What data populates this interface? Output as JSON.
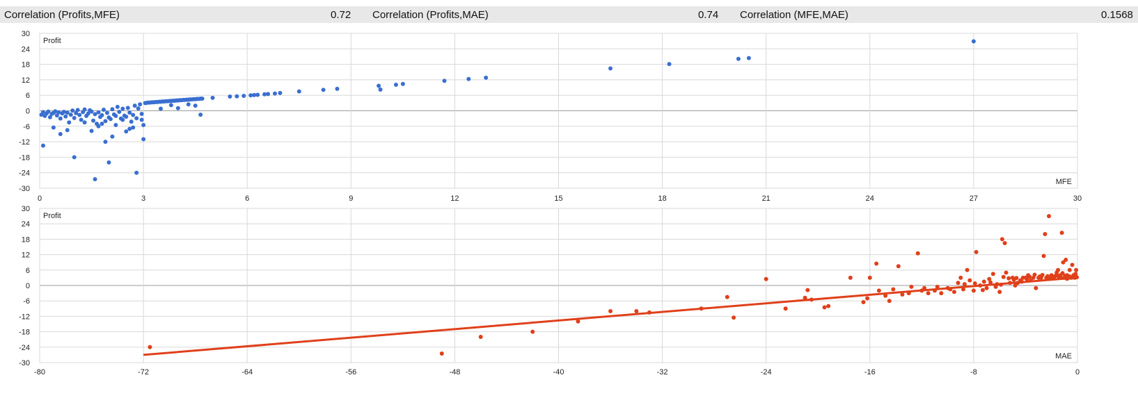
{
  "header": {
    "label1": "Correlation (Profits,MFE)",
    "value1": "0.72",
    "label2": "Correlation (Profits,MAE)",
    "value2": "0.74",
    "label3": "Correlation (MFE,MAE)",
    "value3": "0.1568"
  },
  "chart_data": [
    {
      "type": "scatter",
      "ylabel": "Profit",
      "xlabel": "MFE",
      "xlim": [
        0,
        30
      ],
      "ylim": [
        -30,
        30
      ],
      "xticks": [
        "0",
        "3",
        "6",
        "9",
        "12",
        "15",
        "18",
        "21",
        "24",
        "27",
        "30"
      ],
      "yticks": [
        "30",
        "24",
        "18",
        "12",
        "6",
        "0",
        "-6",
        "-12",
        "-18",
        "-24",
        "-30"
      ],
      "grid": true,
      "color": "#3a6fd0",
      "points": [
        [
          0.05,
          -1.5
        ],
        [
          0.1,
          -0.5
        ],
        [
          0.15,
          -2
        ],
        [
          0.2,
          -1
        ],
        [
          0.25,
          -0.3
        ],
        [
          0.3,
          -2.5
        ],
        [
          0.35,
          -1.2
        ],
        [
          0.4,
          -0.8
        ],
        [
          0.45,
          -0.2
        ],
        [
          0.5,
          -1.8
        ],
        [
          0.55,
          -0.6
        ],
        [
          0.6,
          -3
        ],
        [
          0.65,
          -1
        ],
        [
          0.7,
          -0.4
        ],
        [
          0.75,
          -2.2
        ],
        [
          0.8,
          -0.7
        ],
        [
          0.85,
          -4.5
        ],
        [
          0.9,
          -1.5
        ],
        [
          0.95,
          0.1
        ],
        [
          1.0,
          -2.8
        ],
        [
          1.05,
          -0.9
        ],
        [
          1.1,
          0.3
        ],
        [
          1.15,
          -1.6
        ],
        [
          1.2,
          -3.5
        ],
        [
          1.25,
          -0.5
        ],
        [
          1.3,
          0.5
        ],
        [
          1.35,
          -2
        ],
        [
          1.4,
          -1.1
        ],
        [
          1.45,
          0.2
        ],
        [
          1.5,
          -0.3
        ],
        [
          1.55,
          -3.8
        ],
        [
          1.6,
          -1.3
        ],
        [
          1.65,
          -5
        ],
        [
          1.7,
          -0.6
        ],
        [
          1.75,
          -2.4
        ],
        [
          1.8,
          -1.7
        ],
        [
          1.85,
          0.4
        ],
        [
          1.9,
          -4
        ],
        [
          1.95,
          -0.8
        ],
        [
          2.0,
          -2.6
        ],
        [
          2.05,
          -3.2
        ],
        [
          2.1,
          0.6
        ],
        [
          2.15,
          -1.4
        ],
        [
          2.2,
          -2
        ],
        [
          2.25,
          1.5
        ],
        [
          2.3,
          -0.4
        ],
        [
          2.35,
          -3
        ],
        [
          2.4,
          0.8
        ],
        [
          2.45,
          -1.9
        ],
        [
          2.5,
          -2.3
        ],
        [
          2.55,
          1.1
        ],
        [
          2.6,
          -0.7
        ],
        [
          2.65,
          -4.2
        ],
        [
          2.7,
          -1.6
        ],
        [
          2.75,
          2
        ],
        [
          2.8,
          -2.9
        ],
        [
          2.85,
          0.9
        ],
        [
          2.9,
          2.5
        ],
        [
          2.95,
          -1.2
        ],
        [
          3.0,
          -5.5
        ],
        [
          0.1,
          -13.5
        ],
        [
          0.4,
          -6.5
        ],
        [
          0.6,
          -9
        ],
        [
          0.8,
          -7.5
        ],
        [
          1.0,
          -18
        ],
        [
          1.3,
          -4.5
        ],
        [
          1.5,
          -7.8
        ],
        [
          1.6,
          -26.5
        ],
        [
          1.7,
          -6
        ],
        [
          1.8,
          -5
        ],
        [
          1.9,
          -12
        ],
        [
          2.0,
          -20
        ],
        [
          2.1,
          -10
        ],
        [
          2.2,
          -5.5
        ],
        [
          2.4,
          -3.5
        ],
        [
          2.5,
          -8
        ],
        [
          2.6,
          -7
        ],
        [
          2.7,
          -6.5
        ],
        [
          2.8,
          -24
        ],
        [
          3.0,
          -11
        ],
        [
          2.95,
          -3.5
        ],
        [
          3.05,
          3
        ],
        [
          3.1,
          3.1
        ],
        [
          3.15,
          3.2
        ],
        [
          3.2,
          3.2
        ],
        [
          3.25,
          3.3
        ],
        [
          3.3,
          3.3
        ],
        [
          3.35,
          3.4
        ],
        [
          3.4,
          3.4
        ],
        [
          3.45,
          3.5
        ],
        [
          3.5,
          3.5
        ],
        [
          3.55,
          3.6
        ],
        [
          3.6,
          3.6
        ],
        [
          3.65,
          3.7
        ],
        [
          3.7,
          3.7
        ],
        [
          3.75,
          3.8
        ],
        [
          3.8,
          3.8
        ],
        [
          3.85,
          3.9
        ],
        [
          3.9,
          3.9
        ],
        [
          3.95,
          4
        ],
        [
          4.0,
          4
        ],
        [
          4.05,
          4.1
        ],
        [
          4.1,
          4.1
        ],
        [
          4.15,
          4.2
        ],
        [
          4.2,
          4.2
        ],
        [
          4.25,
          4.3
        ],
        [
          4.3,
          4.3
        ],
        [
          4.35,
          4.4
        ],
        [
          4.4,
          4.4
        ],
        [
          4.45,
          4.5
        ],
        [
          4.5,
          4.5
        ],
        [
          4.55,
          4.6
        ],
        [
          4.6,
          4.6
        ],
        [
          4.65,
          4.7
        ],
        [
          4.7,
          4.7
        ],
        [
          3.5,
          0.8
        ],
        [
          3.8,
          2.2
        ],
        [
          4.0,
          1
        ],
        [
          4.3,
          2.5
        ],
        [
          4.5,
          2
        ],
        [
          4.65,
          -1.5
        ],
        [
          5.0,
          5
        ],
        [
          5.5,
          5.5
        ],
        [
          5.7,
          5.6
        ],
        [
          5.9,
          5.8
        ],
        [
          6.1,
          6
        ],
        [
          6.2,
          6.1
        ],
        [
          6.3,
          6.2
        ],
        [
          6.5,
          6.4
        ],
        [
          6.6,
          6.5
        ],
        [
          6.8,
          6.7
        ],
        [
          6.95,
          6.9
        ],
        [
          7.5,
          7.5
        ],
        [
          8.2,
          8.1
        ],
        [
          8.6,
          8.5
        ],
        [
          9.8,
          9.7
        ],
        [
          9.85,
          8.2
        ],
        [
          10.3,
          10.1
        ],
        [
          10.5,
          10.4
        ],
        [
          11.7,
          11.6
        ],
        [
          12.4,
          12.3
        ],
        [
          12.9,
          12.8
        ],
        [
          16.5,
          16.4
        ],
        [
          18.2,
          18.1
        ],
        [
          20.2,
          20.1
        ],
        [
          20.5,
          20.4
        ],
        [
          27.0,
          26.9
        ]
      ]
    },
    {
      "type": "scatter",
      "ylabel": "Profit",
      "xlabel": "MAE",
      "xlim": [
        -80,
        0
      ],
      "ylim": [
        -30,
        30
      ],
      "xticks": [
        "-80",
        "-72",
        "-64",
        "-56",
        "-48",
        "-40",
        "-32",
        "-24",
        "-16",
        "-8",
        "0"
      ],
      "yticks": [
        "30",
        "24",
        "18",
        "12",
        "6",
        "0",
        "-6",
        "-12",
        "-18",
        "-24",
        "-30"
      ],
      "grid": true,
      "color": "#e0401a",
      "trendline": {
        "x": [
          -72,
          -0.2
        ],
        "y": [
          -27,
          3
        ]
      },
      "points": [
        [
          -71.5,
          -24
        ],
        [
          -49,
          -26.5
        ],
        [
          -46,
          -20
        ],
        [
          -42,
          -18
        ],
        [
          -38.5,
          -14
        ],
        [
          -36,
          -10
        ],
        [
          -34,
          -10
        ],
        [
          -33,
          -10.5
        ],
        [
          -29,
          -9
        ],
        [
          -27,
          -4.5
        ],
        [
          -26.5,
          -12.5
        ],
        [
          -24,
          2.5
        ],
        [
          -22.5,
          -9
        ],
        [
          -21,
          -4.8
        ],
        [
          -20.8,
          -1.8
        ],
        [
          -20.5,
          -5.5
        ],
        [
          -19.5,
          -8.5
        ],
        [
          -19.2,
          -8
        ],
        [
          -17.5,
          3
        ],
        [
          -16.5,
          -6.5
        ],
        [
          -16.2,
          -5
        ],
        [
          -16,
          3
        ],
        [
          -15.5,
          8.5
        ],
        [
          -15.3,
          -2
        ],
        [
          -14.8,
          -4
        ],
        [
          -14.5,
          -6
        ],
        [
          -14.2,
          -1.5
        ],
        [
          -13.8,
          7.5
        ],
        [
          -13.5,
          -3.5
        ],
        [
          -13,
          -3
        ],
        [
          -12.8,
          -0.5
        ],
        [
          -12.3,
          12.5
        ],
        [
          -12,
          -2
        ],
        [
          -11.5,
          -3
        ],
        [
          -11,
          -2
        ],
        [
          -10.5,
          -3
        ],
        [
          -10,
          -1
        ],
        [
          -9.5,
          -2.5
        ],
        [
          -9.2,
          1
        ],
        [
          -9,
          3
        ],
        [
          -8.8,
          -1.5
        ],
        [
          -8.5,
          6
        ],
        [
          -8.3,
          2
        ],
        [
          -8,
          -2
        ],
        [
          -7.8,
          13
        ],
        [
          -7.5,
          0
        ],
        [
          -7.2,
          1.5
        ],
        [
          -7,
          -1
        ],
        [
          -6.8,
          2.5
        ],
        [
          -6.5,
          4.5
        ],
        [
          -6.2,
          0.5
        ],
        [
          -6,
          -2.5
        ],
        [
          -5.8,
          18
        ],
        [
          -5.6,
          16.5
        ],
        [
          -5.5,
          5
        ],
        [
          -5.2,
          1
        ],
        [
          -5,
          3
        ],
        [
          -4.8,
          0
        ],
        [
          -4.6,
          1
        ],
        [
          -4.4,
          2
        ],
        [
          -4.2,
          3
        ],
        [
          -4,
          3
        ],
        [
          -3.8,
          4
        ],
        [
          -3.6,
          2
        ],
        [
          -3.4,
          3
        ],
        [
          -3.2,
          -1
        ],
        [
          -3,
          3
        ],
        [
          -2.8,
          3
        ],
        [
          -2.6,
          11.5
        ],
        [
          -2.5,
          20
        ],
        [
          -2.4,
          3
        ],
        [
          -2.2,
          27
        ],
        [
          -2.0,
          4
        ],
        [
          -1.8,
          3
        ],
        [
          -1.6,
          5
        ],
        [
          -1.5,
          6
        ],
        [
          -1.4,
          3
        ],
        [
          -1.3,
          4
        ],
        [
          -1.2,
          20.5
        ],
        [
          -1.1,
          9
        ],
        [
          -1.0,
          3
        ],
        [
          -0.9,
          10
        ],
        [
          -0.8,
          4
        ],
        [
          -0.7,
          3
        ],
        [
          -0.6,
          6
        ],
        [
          -0.5,
          3
        ],
        [
          -0.4,
          8
        ],
        [
          -0.3,
          4
        ],
        [
          -0.2,
          3
        ],
        [
          -0.1,
          6
        ],
        [
          -9.8,
          -1.5
        ],
        [
          -10.8,
          -0.5
        ],
        [
          -11.8,
          -1
        ],
        [
          -7.3,
          -1.8
        ],
        [
          -6.7,
          1.2
        ],
        [
          -5.9,
          0.3
        ],
        [
          -4.9,
          2.2
        ],
        [
          -3.9,
          2.5
        ],
        [
          -2.9,
          3.5
        ],
        [
          -1.9,
          3.2
        ],
        [
          -0.95,
          3.8
        ],
        [
          -8.7,
          0.5
        ],
        [
          -7.9,
          0.8
        ],
        [
          -6.3,
          -0.5
        ],
        [
          -5.3,
          2.8
        ],
        [
          -4.3,
          1.5
        ],
        [
          -3.3,
          4.2
        ],
        [
          -2.3,
          3.6
        ],
        [
          -1.3,
          3.3
        ],
        [
          -0.35,
          3.1
        ],
        [
          -0.15,
          4.5
        ],
        [
          -0.05,
          3.2
        ],
        [
          -1.7,
          3.7
        ],
        [
          -2.7,
          4.1
        ],
        [
          -3.7,
          3.4
        ],
        [
          -4.7,
          2.9
        ],
        [
          -5.7,
          3.3
        ],
        [
          -0.6,
          3.5
        ],
        [
          -0.8,
          2.6
        ],
        [
          -1.15,
          4.8
        ],
        [
          -1.55,
          3.9
        ],
        [
          -2.15,
          2.7
        ]
      ]
    }
  ]
}
